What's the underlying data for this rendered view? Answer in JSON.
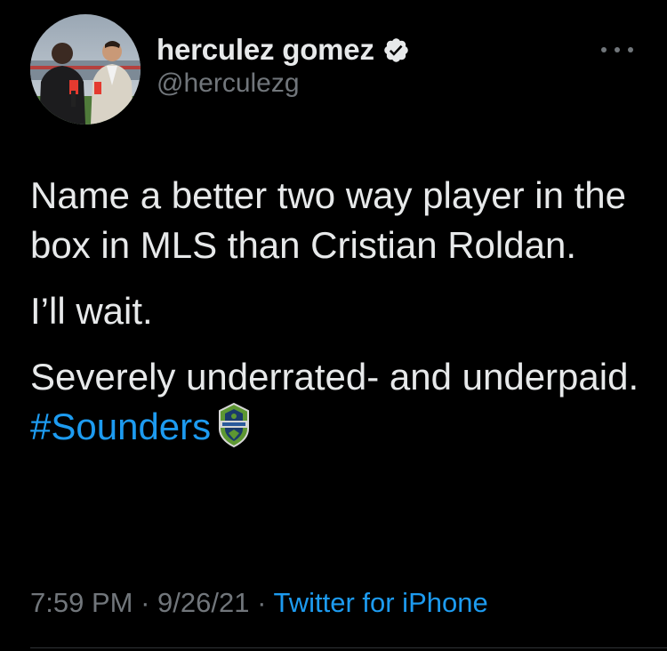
{
  "author": {
    "display_name": "herculez gomez",
    "handle": "@herculezg",
    "verified": true,
    "avatar_icon": "profile-photo"
  },
  "tweet": {
    "paragraphs": [
      "Name a better two way player in the box in MLS than Cristian Roldan.",
      "I’ll wait."
    ],
    "last_paragraph_text": "Severely underrated- and underpaid.",
    "hashtag": "#Sounders",
    "hashtag_emoji": "sounders-crest-icon"
  },
  "meta": {
    "time": "7:59 PM",
    "separator": "·",
    "date": "9/26/21",
    "source": "Twitter for iPhone"
  },
  "colors": {
    "background": "#000000",
    "text": "#e7e9ea",
    "secondary": "#71767b",
    "link": "#1d9bf0"
  }
}
